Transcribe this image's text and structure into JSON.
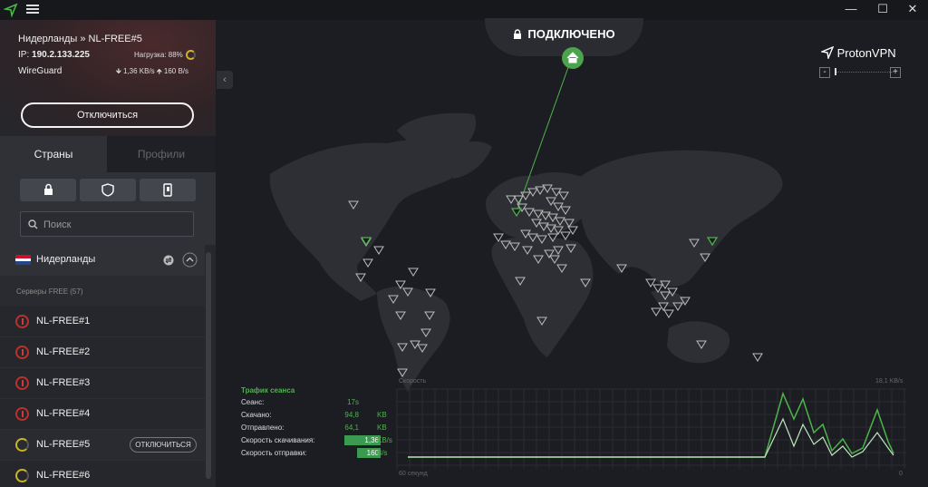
{
  "titlebar": {
    "minimize": "—",
    "maximize": "☐",
    "close": "✕"
  },
  "connection": {
    "title": "Нидерланды » NL-FREE#5",
    "ip_label": "IP: ",
    "ip": "190.2.133.225",
    "load": "Нагрузка: 88%",
    "load_value": 0.88,
    "protocol": "WireGuard",
    "down_speed": "1,36 KB/s",
    "up_speed": "160 B/s",
    "disconnect_label": "Отключиться"
  },
  "tabs": {
    "countries": "Страны",
    "profiles": "Профили"
  },
  "search": {
    "placeholder": "Поиск"
  },
  "country": {
    "name": "Нидерланды",
    "subheader": "Серверы FREE (57)"
  },
  "servers": [
    {
      "name": "NL-FREE#1"
    },
    {
      "name": "NL-FREE#2"
    },
    {
      "name": "NL-FREE#3"
    },
    {
      "name": "NL-FREE#4"
    },
    {
      "name": "NL-FREE#5",
      "action": "ОТКЛЮЧИТЬСЯ"
    },
    {
      "name": "NL-FREE#6"
    }
  ],
  "status": {
    "label": "ПОДКЛЮЧЕНО"
  },
  "brand": {
    "name": "ProtonVPN"
  },
  "zoom": {
    "minus": "-",
    "plus": "+"
  },
  "traffic": {
    "title": "Трафик сеанса",
    "rows": [
      {
        "label": "Сеанс:",
        "value": "17s",
        "unit": ""
      },
      {
        "label": "Скачано:",
        "value": "94,8",
        "unit": "KB"
      },
      {
        "label": "Отправлено:",
        "value": "64,1",
        "unit": "KB"
      },
      {
        "label": "Скорость скачивания:",
        "value": "1,36",
        "unit": "KB/s"
      },
      {
        "label": "Скорость отправки:",
        "value": "160",
        "unit": "B/s"
      }
    ],
    "graph_title": "Скорость",
    "graph_max": "18,1 KB/s",
    "graph_left": "60 секунд",
    "graph_right": "0"
  },
  "colors": {
    "accent": "#4cb44c",
    "background": "#1c1d22",
    "sidebar": "#25272c"
  }
}
